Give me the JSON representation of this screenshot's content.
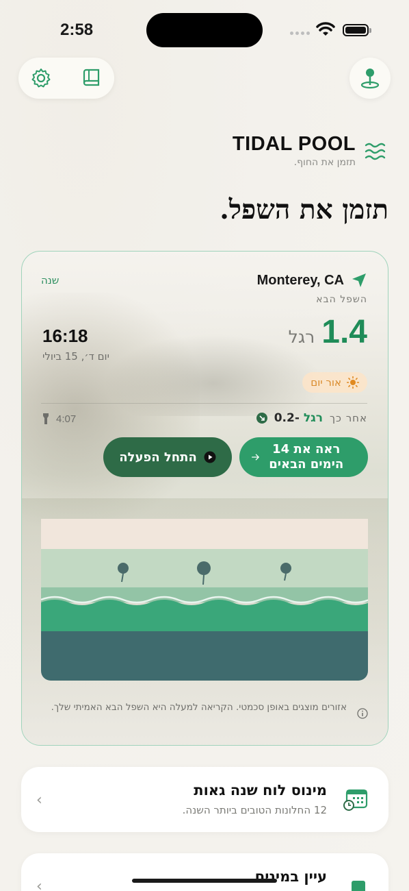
{
  "status_bar": {
    "time": "2:58"
  },
  "brand": {
    "title": "TIDAL POOL",
    "subtitle": "תזמן את החוף."
  },
  "headline": "תזמן את השפל.",
  "card": {
    "location": "Monterey, CA",
    "year_link": "שנה",
    "next_low_label": "השפל הבא",
    "height_value": "1.4",
    "height_unit": "רגל",
    "low_time": "16:18",
    "low_date": "יום ד׳, 15 ביולי",
    "daylight_badge": "אור יום",
    "after_label": "אחר כך",
    "after_value": "-0.2",
    "after_unit": "רגל",
    "after_time": "4:07",
    "primary_button": "ראה את 14 הימים הבאים",
    "secondary_button": "התחל הפעלה",
    "zones_note": "אזורים מוצגים באופן סכמטי. הקריאה למעלה היא השפל הבא האמיתי שלך."
  },
  "list": [
    {
      "title": "מינוס לוח שנה גאות",
      "subtitle": "12 החלונות הטובים ביותר השנה."
    },
    {
      "title": "עיין במינים",
      "subtitle": ""
    }
  ],
  "colors": {
    "accent": "#2e9d6a",
    "dark_accent": "#2e6b47",
    "daylight": "#d98a2a"
  }
}
